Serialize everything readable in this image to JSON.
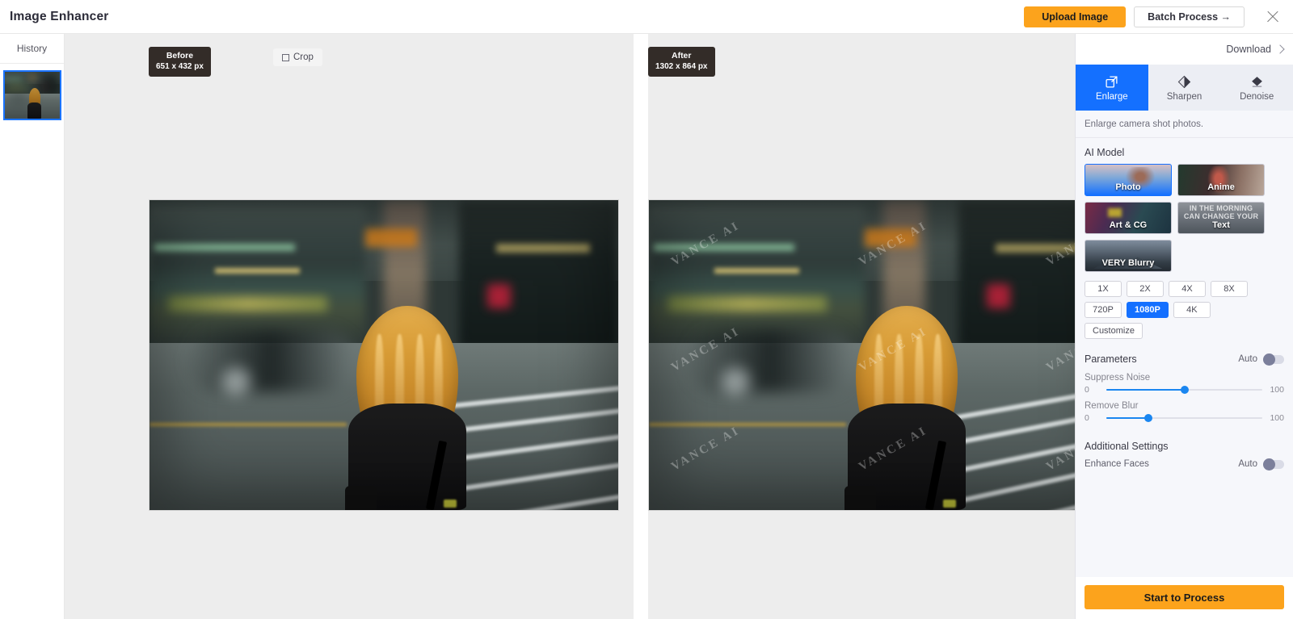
{
  "app": {
    "title": "Image Enhancer"
  },
  "topbar": {
    "upload_label": "Upload Image",
    "batch_label": "Batch Process →",
    "close_icon": "close-icon"
  },
  "sidebar": {
    "history_label": "History",
    "thumbnail_alt": "street-photo-thumbnail"
  },
  "canvas": {
    "before": {
      "label": "Before",
      "dimensions": "651 x 432 px"
    },
    "after": {
      "label": "After",
      "dimensions": "1302 x 864 px"
    },
    "crop_label": "Crop",
    "crop_icon": "crop-icon",
    "watermark_text": "VANCE AI"
  },
  "panel": {
    "download_label": "Download",
    "download_chevron": "chevron-right-icon",
    "tabs": [
      {
        "label": "Enlarge",
        "icon": "enlarge-icon",
        "active": true
      },
      {
        "label": "Sharpen",
        "icon": "sharpen-icon",
        "active": false
      },
      {
        "label": "Denoise",
        "icon": "denoise-icon",
        "active": false
      }
    ],
    "tab_description": "Enlarge camera shot photos.",
    "ai_model_label": "AI Model",
    "models": [
      {
        "label": "Photo",
        "selected": true
      },
      {
        "label": "Anime",
        "selected": false
      },
      {
        "label": "Art & CG",
        "selected": false
      },
      {
        "label": "Text",
        "selected": false,
        "thumb_text": "IN THE MORNING CAN CHANGE YOUR"
      },
      {
        "label": "VERY Blurry",
        "selected": false
      }
    ],
    "scale_chips": [
      {
        "label": "1X",
        "active": false
      },
      {
        "label": "2X",
        "active": false
      },
      {
        "label": "4X",
        "active": false
      },
      {
        "label": "8X",
        "active": false
      }
    ],
    "resolution_chips": [
      {
        "label": "720P",
        "active": false
      },
      {
        "label": "1080P",
        "active": true
      },
      {
        "label": "4K",
        "active": false
      }
    ],
    "customize_chip": {
      "label": "Customize",
      "active": false
    },
    "parameters": {
      "title": "Parameters",
      "auto_label": "Auto",
      "auto_on": false,
      "sliders": [
        {
          "label": "Suppress Noise",
          "min": "0",
          "max": "100",
          "value": 50
        },
        {
          "label": "Remove Blur",
          "min": "0",
          "max": "100",
          "value": 27
        }
      ]
    },
    "additional": {
      "title": "Additional Settings",
      "enhance_faces_label": "Enhance Faces",
      "auto_label": "Auto",
      "auto_on": false
    },
    "start_label": "Start to Process"
  },
  "colors": {
    "accent_orange": "#fca31c",
    "accent_blue": "#1470ff",
    "slider_blue": "#1a86f0",
    "canvas_bg": "#ededed",
    "panel_bg": "#f6f7fb",
    "badge_bg": "#332c28"
  }
}
